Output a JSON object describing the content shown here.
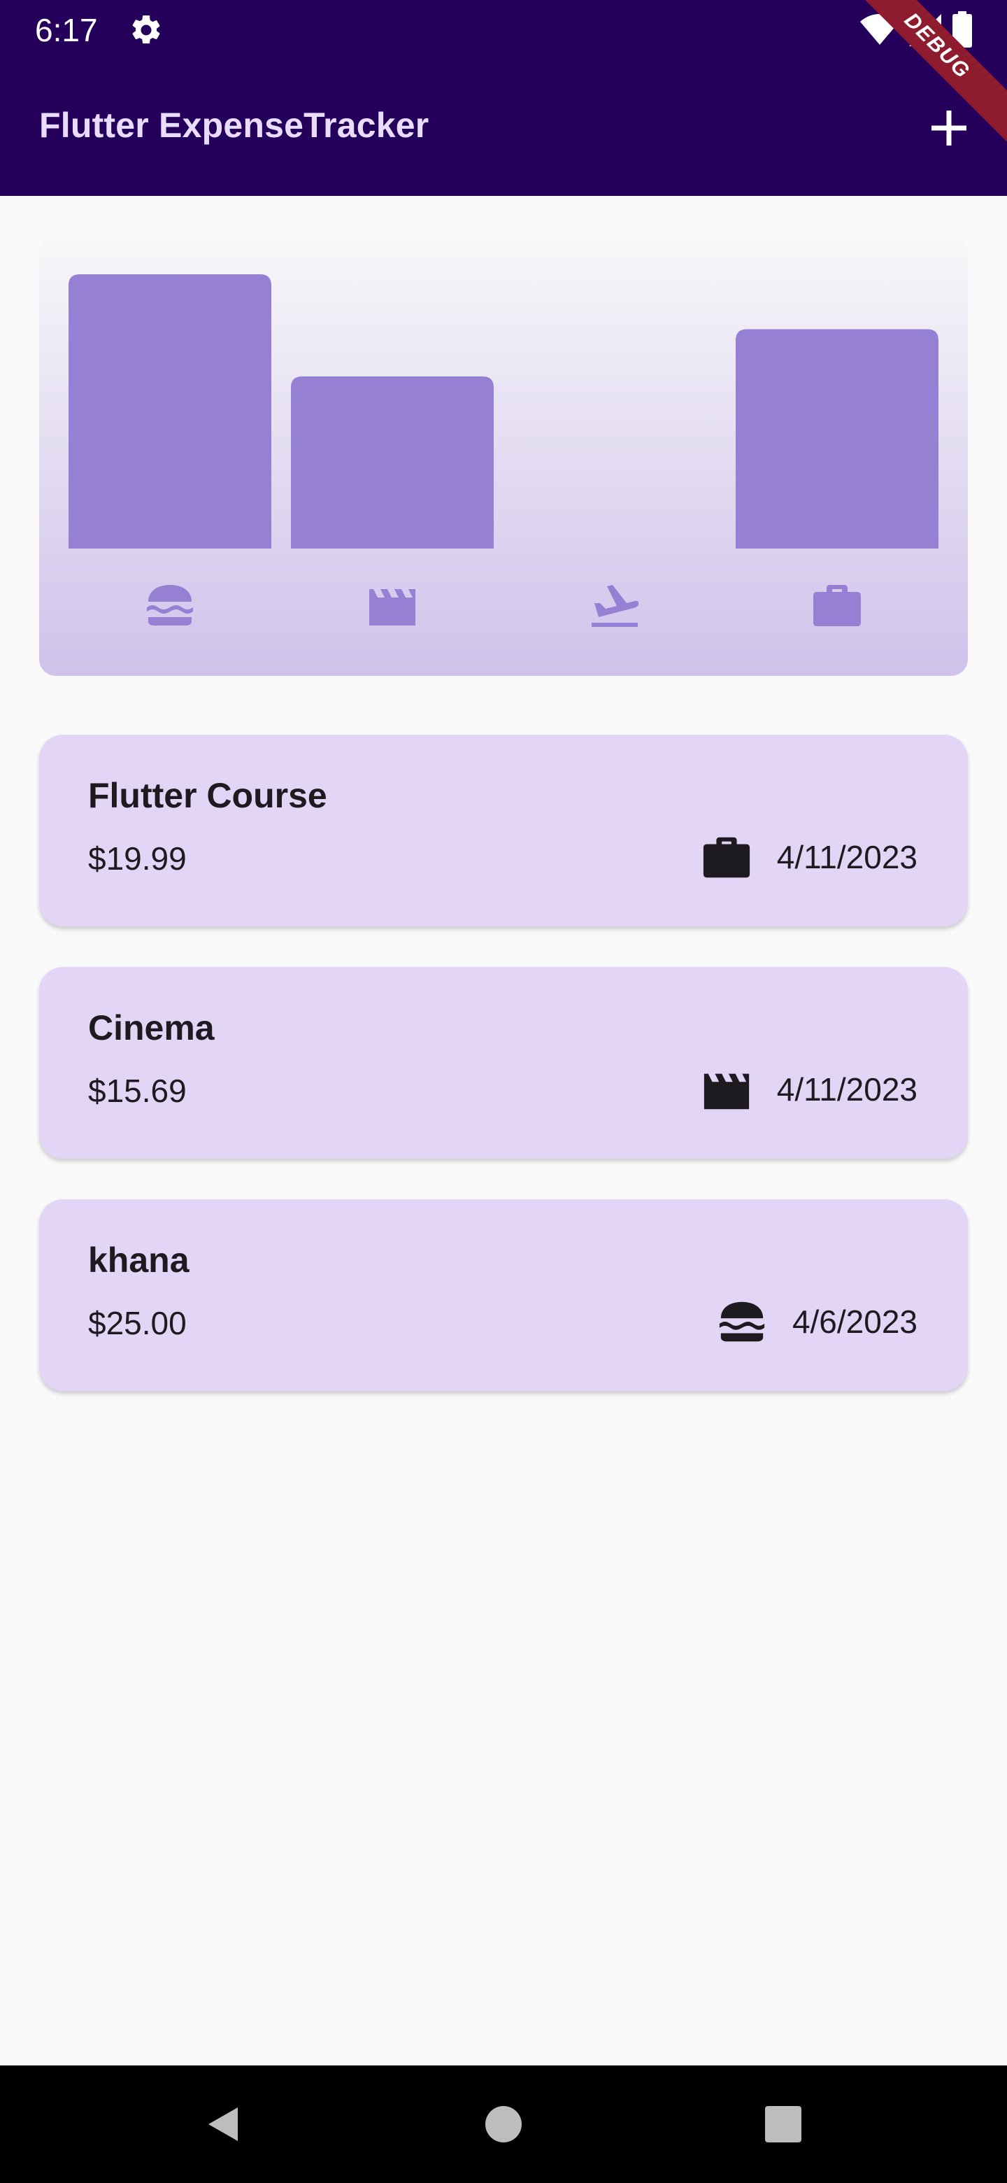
{
  "status_bar": {
    "time": "6:17",
    "icons": [
      "gear-icon",
      "wifi-icon",
      "signal-icon",
      "battery-icon"
    ]
  },
  "app_bar": {
    "title": "Flutter ExpenseTracker",
    "add_icon": "plus-icon",
    "debug_banner": "DEBUG",
    "background": "#25005B"
  },
  "chart_data": {
    "type": "bar",
    "categories": [
      "food",
      "leisure",
      "travel",
      "work"
    ],
    "category_icons": [
      "burger-icon",
      "clapperboard-icon",
      "airplane-takeoff-icon",
      "briefcase-icon"
    ],
    "values": [
      25.0,
      15.69,
      0,
      19.99
    ],
    "ylim": [
      0,
      25.0
    ],
    "bar_color": "#9680D4",
    "grid": false
  },
  "expenses": [
    {
      "title": "Flutter Course",
      "amount": "$19.99",
      "icon": "briefcase-icon",
      "date": "4/11/2023"
    },
    {
      "title": "Cinema",
      "amount": "$15.69",
      "icon": "clapperboard-icon",
      "date": "4/11/2023"
    },
    {
      "title": "khana",
      "amount": "$25.00",
      "icon": "burger-icon",
      "date": "4/6/2023"
    }
  ],
  "nav_bar": {
    "icons": [
      "back-icon",
      "home-icon",
      "recents-icon"
    ]
  },
  "colors": {
    "accent": "#9680D4",
    "card": "#E2D5F5",
    "text": "#1D1B20"
  }
}
